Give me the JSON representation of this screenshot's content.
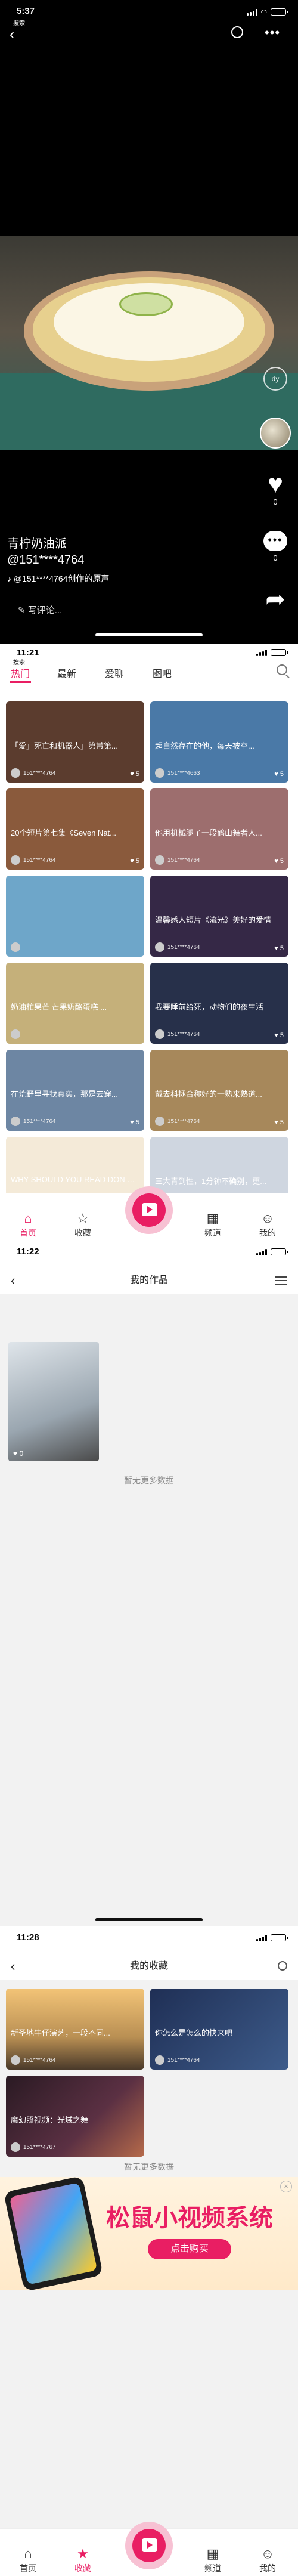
{
  "colors": {
    "accent": "#e91e63",
    "nomore_text": "#8a8a8a"
  },
  "screen1": {
    "status": {
      "time": "5:37",
      "back": "搜索",
      "battery": ""
    },
    "video": {
      "title": "青柠奶油派",
      "user": "@151****4764",
      "music": "@151****4764创作的原声",
      "comment_placeholder": "写评论..."
    },
    "rail": {
      "likes": "0",
      "comments": "0"
    },
    "icons": [
      "back-icon",
      "search-icon",
      "more-icon",
      "heart-icon",
      "comment-icon",
      "share-icon",
      "music-icon",
      "pencil-icon"
    ]
  },
  "screen2": {
    "status": {
      "time": "11:21",
      "back": "搜索"
    },
    "tabs": [
      "热门",
      "最新",
      "爱聊",
      "图吧"
    ],
    "cards": [
      {
        "caption": "「爱」死亡和机器人」第带第...",
        "user": "151****4764",
        "likes": "5",
        "bg": "#5b3c2e"
      },
      {
        "caption": "超自然存在的他，每天被空...",
        "user": "151****4663",
        "likes": "5",
        "bg": "#4a79a7"
      },
      {
        "caption": "20个短片第七集《Seven Nat...",
        "user": "151****4764",
        "likes": "5",
        "bg": "#8a5a3c"
      },
      {
        "caption": "他用机械腿了一段鹤山舞者人...",
        "user": "151****4764",
        "likes": "5",
        "bg": "#9d6e6e"
      },
      {
        "caption": "",
        "user": "",
        "likes": "",
        "bg": "#6ea6c9"
      },
      {
        "caption": "温馨感人短片《流光》美好的爱情",
        "user": "151****4764",
        "likes": "5",
        "bg": "#352846"
      },
      {
        "caption": "奶油杧果芒 芒果奶酪蛋糕 ...",
        "user": "",
        "likes": "",
        "bg": "#c5b07a"
      },
      {
        "caption": "我要睡前给死，动物们的夜生活",
        "user": "151****4764",
        "likes": "5",
        "bg": "#27304a"
      },
      {
        "caption": "在荒野里寻找真实，那是去穿...",
        "user": "151****4764",
        "likes": "5",
        "bg": "#6d86a3"
      },
      {
        "caption": "戴去科拯合称好的一熟来熟道...",
        "user": "151****4764",
        "likes": "5",
        "bg": "#a7885b"
      },
      {
        "caption": "WHY SHOULD YOU READ DON QUIXOTE?",
        "user": "",
        "likes": "",
        "bg": "#f4ead8"
      },
      {
        "caption": "三大青到性，1分钟不确别，更...",
        "user": "",
        "likes": "",
        "bg": "#cfd6e0"
      }
    ],
    "nav": [
      "首页",
      "收藏",
      "频道",
      "我的"
    ]
  },
  "screen3": {
    "status": {
      "time": "11:22"
    },
    "header": "我的作品",
    "back_icon": "back-icon",
    "thumb_likes": "0",
    "nomore": "暂无更多数据"
  },
  "screen4": {
    "status": {
      "time": "11:28"
    },
    "header": "我的收藏",
    "items": [
      {
        "caption": "新圣地牛仔演艺，一段不同...",
        "user": "151****4764",
        "bg": "#b98f53"
      },
      {
        "caption": "你怎么是怎么的快来吧",
        "user": "151****4764",
        "bg": "#1f2f55"
      },
      {
        "caption": "魔幻照视频：光域之舞",
        "user": "151****4767",
        "bg": "#5b3043"
      }
    ],
    "nomore": "暂无更多数据",
    "ad": {
      "title": "松鼠小视频系统",
      "button": "点击购买"
    },
    "nav": [
      "首页",
      "收藏",
      "频道",
      "我的"
    ]
  }
}
